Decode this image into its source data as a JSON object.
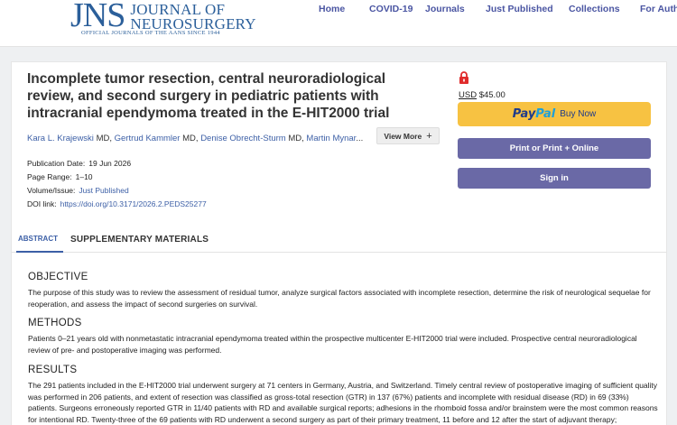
{
  "header": {
    "logo_mark": "JNS",
    "logo_line1": "JOURNAL OF",
    "logo_line2": "NEUROSURGERY",
    "logo_tagline": "OFFICIAL JOURNALS OF THE AANS SINCE 1944",
    "nav": [
      "Home",
      "COVID-19",
      "Journals",
      "Just Published",
      "Collections",
      "For Autho"
    ]
  },
  "article": {
    "title": "Incomplete tumor resection, central neuroradiological review, and second surgery in pediatric patients with intracranial ependymoma treated in the E-HIT2000 trial",
    "authors": [
      {
        "name": "Kara L. Krajewski",
        "degree": "MD"
      },
      {
        "name": "Gertrud Kammler",
        "degree": "MD"
      },
      {
        "name": "Denise Obrecht-Sturm",
        "degree": "MD"
      },
      {
        "name": "Martin Mynar",
        "degree": ""
      }
    ],
    "authors_trailing": "...",
    "view_more_label": "View More",
    "meta": {
      "pub_date_label": "Publication Date:",
      "pub_date": "19 Jun 2026",
      "page_range_label": "Page Range:",
      "page_range": "1–10",
      "volume_label": "Volume/Issue:",
      "volume": "Just Published",
      "doi_label": "DOI link:",
      "doi": "https://doi.org/10.3171/2026.2.PEDS25277"
    }
  },
  "purchase": {
    "currency": "USD",
    "price": "$45.00",
    "paypal_pay": "Pay",
    "paypal_pal": "Pal",
    "paypal_buy": "Buy Now",
    "print_label": "Print or Print + Online",
    "signin_label": "Sign in"
  },
  "tabs": {
    "abstract": "ABSTRACT",
    "supplementary": "SUPPLEMENTARY MATERIALS"
  },
  "abstract": {
    "objective_heading": "OBJECTIVE",
    "objective_text": "The purpose of this study was to review the assessment of residual tumor, analyze surgical factors associated with incomplete resection, determine the risk of neurological sequelae for reoperation, and assess the impact of second surgeries on survival.",
    "methods_heading": "METHODS",
    "methods_text": "Patients 0–21 years old with nonmetastatic intracranial ependymoma treated within the prospective multicenter E-HIT2000 trial were included. Prospective central neuroradiological review of pre- and postoperative imaging was performed.",
    "results_heading": "RESULTS",
    "results_text": "The 291 patients included in the E-HIT2000 trial underwent surgery at 71 centers in Germany, Austria, and Switzerland. Timely central review of postoperative imaging of sufficient quality was performed in 206 patients, and extent of resection was classified as gross-total resection (GTR) in 137 (67%) patients and incomplete with residual disease (RD) in 69 (33%) patients. Surgeons erroneously reported GTR in 11/40 patients with RD and available surgical reports; adhesions in the rhomboid fossa and/or brainstem were the most common reasons for intentional RD. Twenty-three of the 69 patients with RD underwent a second surgery as part of their primary treatment, 11 before and 12 after the start of adjuvant therapy;"
  },
  "colors": {
    "brand_blue": "#2b5f9a",
    "nav_purple": "#4a55a2",
    "link_blue": "#3c5fa6",
    "paypal_yellow": "#f7c242",
    "button_purple": "#6a69a6",
    "lock_red": "#e02b2b"
  }
}
